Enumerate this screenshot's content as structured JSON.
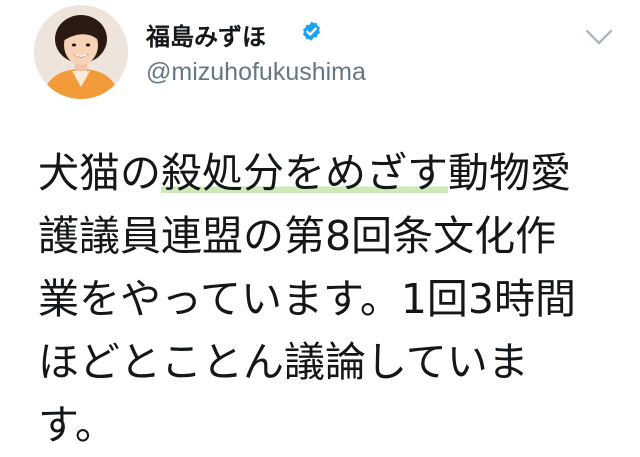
{
  "user": {
    "display_name": "福島みずほ",
    "handle": "@mizuhofukushima",
    "avatar_icon": "profile-photo",
    "verified_icon": "verified-badge-icon",
    "verified_color": "#1da1f2"
  },
  "menu": {
    "caret_icon": "chevron-down-icon"
  },
  "tweet": {
    "line1_a": "犬猫の",
    "line1_highlight": "殺処分をめざす",
    "line1_b": "動物愛",
    "line2": "護議員連盟の第8回条文化作",
    "line3": "業をやっています。1回3時間",
    "line4": "ほどとことん議論していま",
    "line5": "す。",
    "highlight_color": "#cde9b6"
  }
}
